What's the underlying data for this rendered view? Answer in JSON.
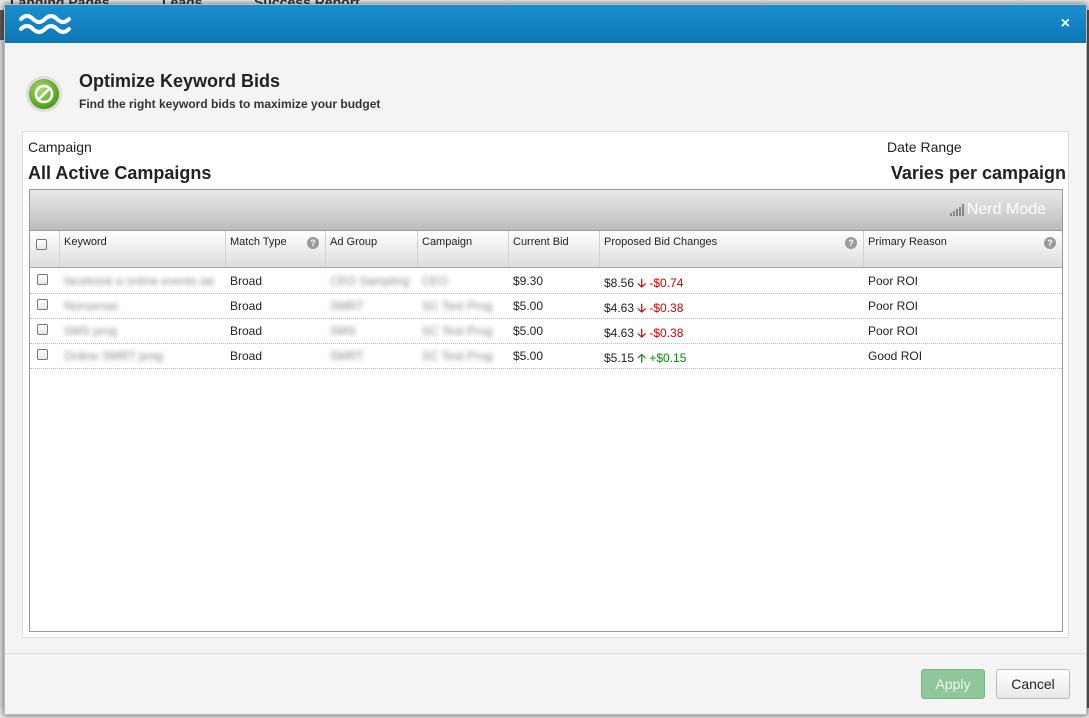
{
  "background": {
    "tabs": [
      "Landing Pages",
      "Leads",
      "Success Report"
    ]
  },
  "modal": {
    "title": "Optimize Keyword Bids",
    "subtitle": "Find the right keyword bids to maximize your budget",
    "close_label": "×"
  },
  "filters": {
    "campaign_label": "Campaign",
    "campaign_value": "All Active Campaigns",
    "date_range_label": "Date Range",
    "date_range_value": "Varies per campaign"
  },
  "toolbar": {
    "nerd_mode_label": "Nerd Mode"
  },
  "table": {
    "columns": [
      "Keyword",
      "Match Type",
      "Ad Group",
      "Campaign",
      "Current Bid",
      "Proposed Bid Changes",
      "Primary Reason"
    ],
    "rows": [
      {
        "keyword": "facebook a online events ad",
        "match_type": "Broad",
        "ad_group": "CEO Sampling",
        "campaign": "CEO",
        "current_bid": "$9.30",
        "proposed_bid": "$8.56",
        "change": "-$0.74",
        "direction": "down",
        "reason": "Poor ROI"
      },
      {
        "keyword": "Nonsense",
        "match_type": "Broad",
        "ad_group": "SMRT",
        "campaign": "SC Test Prog",
        "current_bid": "$5.00",
        "proposed_bid": "$4.63",
        "change": "-$0.38",
        "direction": "down",
        "reason": "Poor ROI"
      },
      {
        "keyword": "SMS prog",
        "match_type": "Broad",
        "ad_group": "SMS",
        "campaign": "SC Test Prog",
        "current_bid": "$5.00",
        "proposed_bid": "$4.63",
        "change": "-$0.38",
        "direction": "down",
        "reason": "Poor ROI"
      },
      {
        "keyword": "Online SMRT prog",
        "match_type": "Broad",
        "ad_group": "SMRT",
        "campaign": "SC Test Prog",
        "current_bid": "$5.00",
        "proposed_bid": "$5.15",
        "change": "+$0.15",
        "direction": "up",
        "reason": "Good ROI"
      }
    ]
  },
  "buttons": {
    "apply": "Apply",
    "cancel": "Cancel"
  },
  "colors": {
    "titlebar": "#0b77b5",
    "decrease": "#d30000",
    "increase": "#0a8a0a",
    "apply_button": "#8fc79a"
  }
}
